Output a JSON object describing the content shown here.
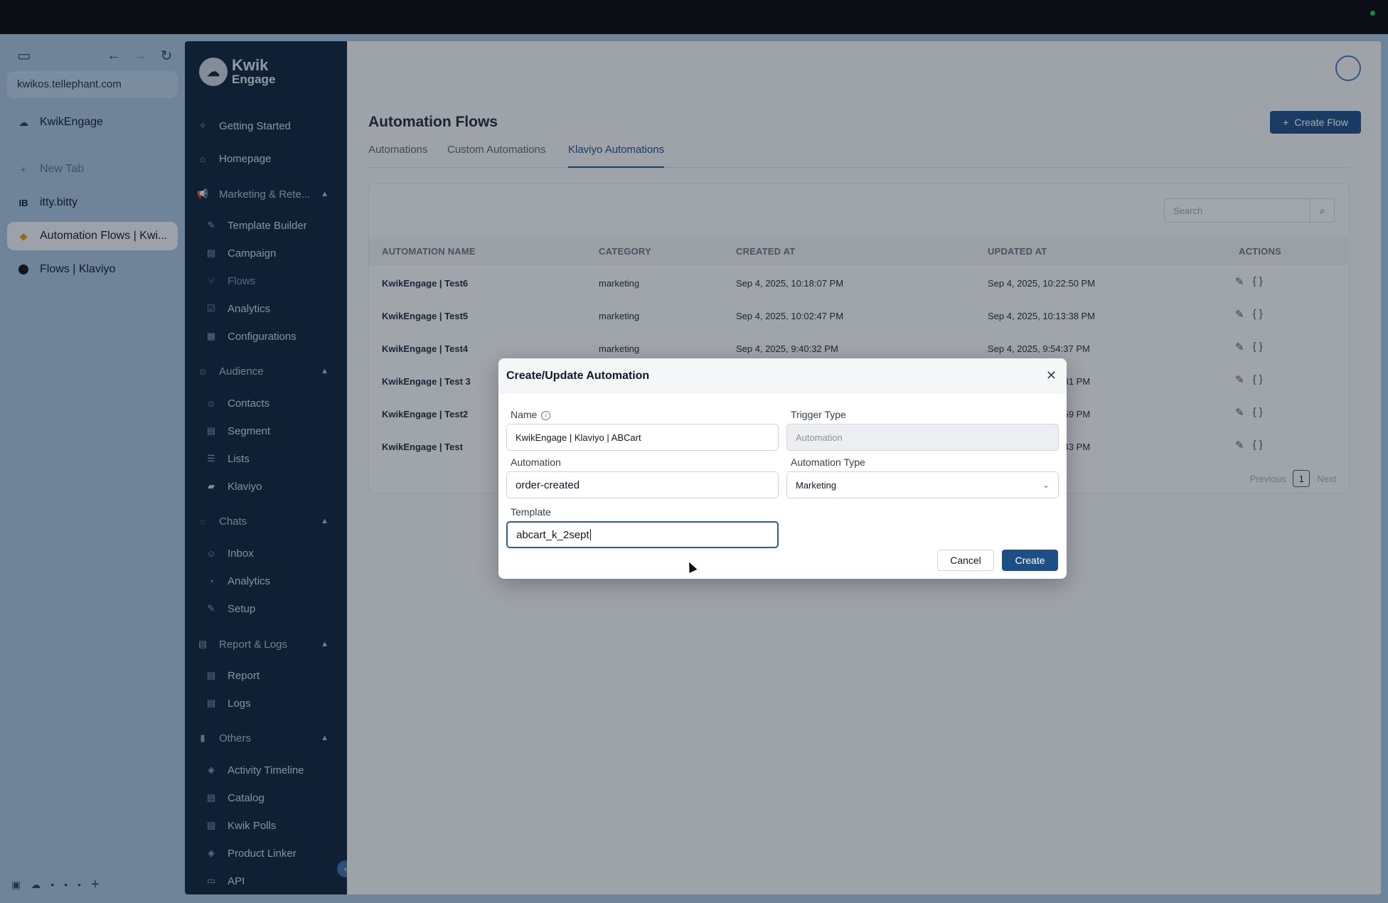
{
  "browser": {
    "url": "kwikos.tellephant.com",
    "tabs": [
      {
        "label": "KwikEngage",
        "icon": "kwikengage-favicon"
      },
      {
        "label": "New Tab",
        "icon": "plus-icon"
      },
      {
        "label": "itty.bitty",
        "icon": "ib-favicon"
      },
      {
        "label": "Automation Flows | Kwi...",
        "icon": "kwik-favicon",
        "active": true
      },
      {
        "label": "Flows | Klaviyo",
        "icon": "klaviyo-favicon"
      }
    ]
  },
  "logo": {
    "line1": "Kwik",
    "line2": "Engage"
  },
  "sidebar": {
    "getting_started": "Getting Started",
    "homepage": "Homepage",
    "marketing": "Marketing & Rete...",
    "marketing_items": [
      "Template Builder",
      "Campaign",
      "Flows",
      "Analytics",
      "Configurations"
    ],
    "audience": "Audience",
    "audience_items": [
      "Contacts",
      "Segment",
      "Lists",
      "Klaviyo"
    ],
    "chats": "Chats",
    "chats_items": [
      "Inbox",
      "Analytics",
      "Setup"
    ],
    "reports": "Report & Logs",
    "reports_items": [
      "Report",
      "Logs"
    ],
    "others": "Others",
    "others_items": [
      "Activity Timeline",
      "Catalog",
      "Kwik Polls",
      "Product Linker",
      "API"
    ]
  },
  "main": {
    "title": "Automation Flows",
    "create_flow": "Create Flow",
    "tabs": [
      "Automations",
      "Custom Automations",
      "Klaviyo Automations"
    ],
    "active_tab": "Klaviyo Automations",
    "search_placeholder": "Search",
    "columns": [
      "AUTOMATION NAME",
      "CATEGORY",
      "CREATED AT",
      "UPDATED AT",
      "ACTIONS"
    ],
    "rows": [
      {
        "name": "KwikEngage | Test6",
        "category": "marketing",
        "created": "Sep 4, 2025, 10:18:07 PM",
        "updated": "Sep 4, 2025, 10:22:50 PM"
      },
      {
        "name": "KwikEngage | Test5",
        "category": "marketing",
        "created": "Sep 4, 2025, 10:02:47 PM",
        "updated": "Sep 4, 2025, 10:13:38 PM"
      },
      {
        "name": "KwikEngage | Test4",
        "category": "marketing",
        "created": "Sep 4, 2025, 9:40:32 PM",
        "updated": "Sep 4, 2025, 9:54:37 PM"
      },
      {
        "name": "KwikEngage | Test 3",
        "category": "",
        "created": "",
        "updated": ":31 PM"
      },
      {
        "name": "KwikEngage | Test2",
        "category": "",
        "created": "",
        "updated": ":59 PM"
      },
      {
        "name": "KwikEngage | Test",
        "category": "",
        "created": "",
        "updated": ":43 PM"
      }
    ],
    "pager": {
      "previous": "Previous",
      "page": "1",
      "next": "Next"
    }
  },
  "modal": {
    "title": "Create/Update Automation",
    "name_label": "Name",
    "name_value": "KwikEngage | Klaviyo | ABCart",
    "trigger_label": "Trigger Type",
    "trigger_value": "Automation",
    "automation_label": "Automation",
    "automation_value": "order-created",
    "automation_type_label": "Automation Type",
    "automation_type_value": "Marketing",
    "template_label": "Template",
    "template_value": "abcart_k_2sept",
    "cancel": "Cancel",
    "create": "Create"
  }
}
